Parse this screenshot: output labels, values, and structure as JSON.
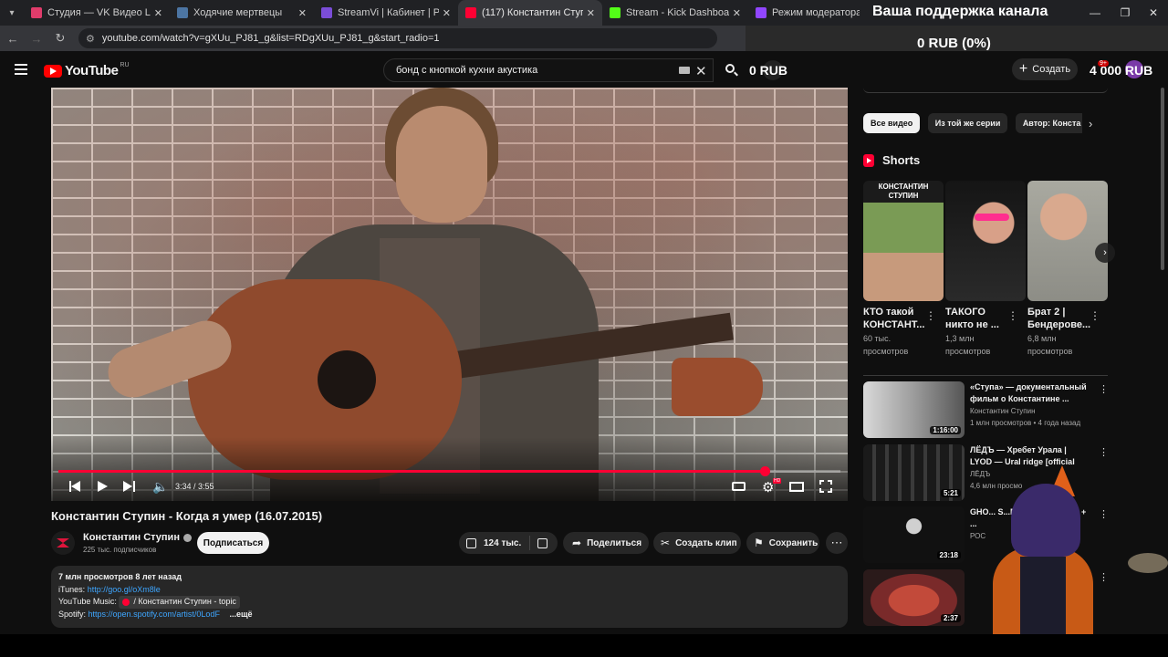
{
  "browser": {
    "tabs": [
      {
        "label": "Студия — VK Видео Live",
        "color": "#e03c6b",
        "active": false
      },
      {
        "label": "Ходячие мертвецы",
        "color": "#4c75a3",
        "active": false
      },
      {
        "label": "StreamVi | Кабинет | Profile set",
        "color": "#7b4dd8",
        "active": false
      },
      {
        "label": "(117) Константин Ступин - Ког",
        "color": "#ff0033",
        "active": true
      },
      {
        "label": "Stream - Kick Dashboard",
        "color": "#53fc18",
        "active": false
      },
      {
        "label": "Режим модератора на канале",
        "color": "#9146ff",
        "active": false
      }
    ],
    "url": "youtube.com/watch?v=gXUu_PJ81_g&list=RDgXUu_PJ81_g&start_radio=1"
  },
  "donation": {
    "title": "Ваша поддержка канала",
    "amount": "0 RUB (0%)"
  },
  "header": {
    "logo_text": "YouTube",
    "region": "RU",
    "search_query": "бонд с кнопкой кухни акустика",
    "rub_left": "0 RUB",
    "create_label": "Создать",
    "rub_right": "4 000 RUB",
    "notif_count": "9+"
  },
  "player": {
    "time": "3:34 / 3:55",
    "progress": 0.903
  },
  "video": {
    "title": "Константин Ступин - Когда я умер (16.07.2015)",
    "channel": "Константин Ступин",
    "subs": "225 тыс. подписчиков",
    "subscribe": "Подписаться",
    "likes": "124 тыс.",
    "share": "Поделиться",
    "clip": "Создать клип",
    "save": "Сохранить"
  },
  "description": {
    "stats": "7 млн просмотров  8 лет назад",
    "itunes_label": "iTunes:",
    "itunes_link": "http://goo.gl/oXm8le",
    "ytmusic_label": "YouTube Music:",
    "ytmusic_sep": "/",
    "ytmusic_topic": "Константин Ступин - topic",
    "spotify_label": "Spotify:",
    "spotify_link": "https://open.spotify.com/artist/0LodF",
    "more": "...ещё"
  },
  "sidebar": {
    "chips": [
      "Все видео",
      "Из той же серии",
      "Автор: Конста"
    ],
    "shorts_title": "Shorts",
    "shorts": [
      {
        "title": "КТО такой КОНСТАНТ...",
        "views": "60 тыс. просмотров",
        "thumb_text": "КОНСТАНТИН СТУПИН"
      },
      {
        "title": "ТАКОГО никто не ...",
        "views": "1,3 млн просмотров",
        "thumb_text": ""
      },
      {
        "title": "Брат 2 | Бендерове...",
        "views": "6,8 млн просмотров",
        "thumb_text": ""
      }
    ],
    "recommended": [
      {
        "title": "«Ступа» — документальный фильм о Константине ...",
        "channel": "Константин Ступин",
        "meta": "1 млн просмотров • 4 года назад",
        "duration": "1:16:00"
      },
      {
        "title": "ЛЁДЪ — Хребет Урала | LYOD — Ural ridge [official music ...",
        "channel": "ЛЁДЪ",
        "meta": "4,6 млн просмо",
        "duration": "5:21"
      },
      {
        "title": "GHO... S...MON GHOS... W... + ...",
        "channel": "РОС",
        "meta": "",
        "duration": "23:18"
      },
      {
        "title": "",
        "channel": "",
        "meta": "",
        "duration": "2:37"
      }
    ]
  }
}
